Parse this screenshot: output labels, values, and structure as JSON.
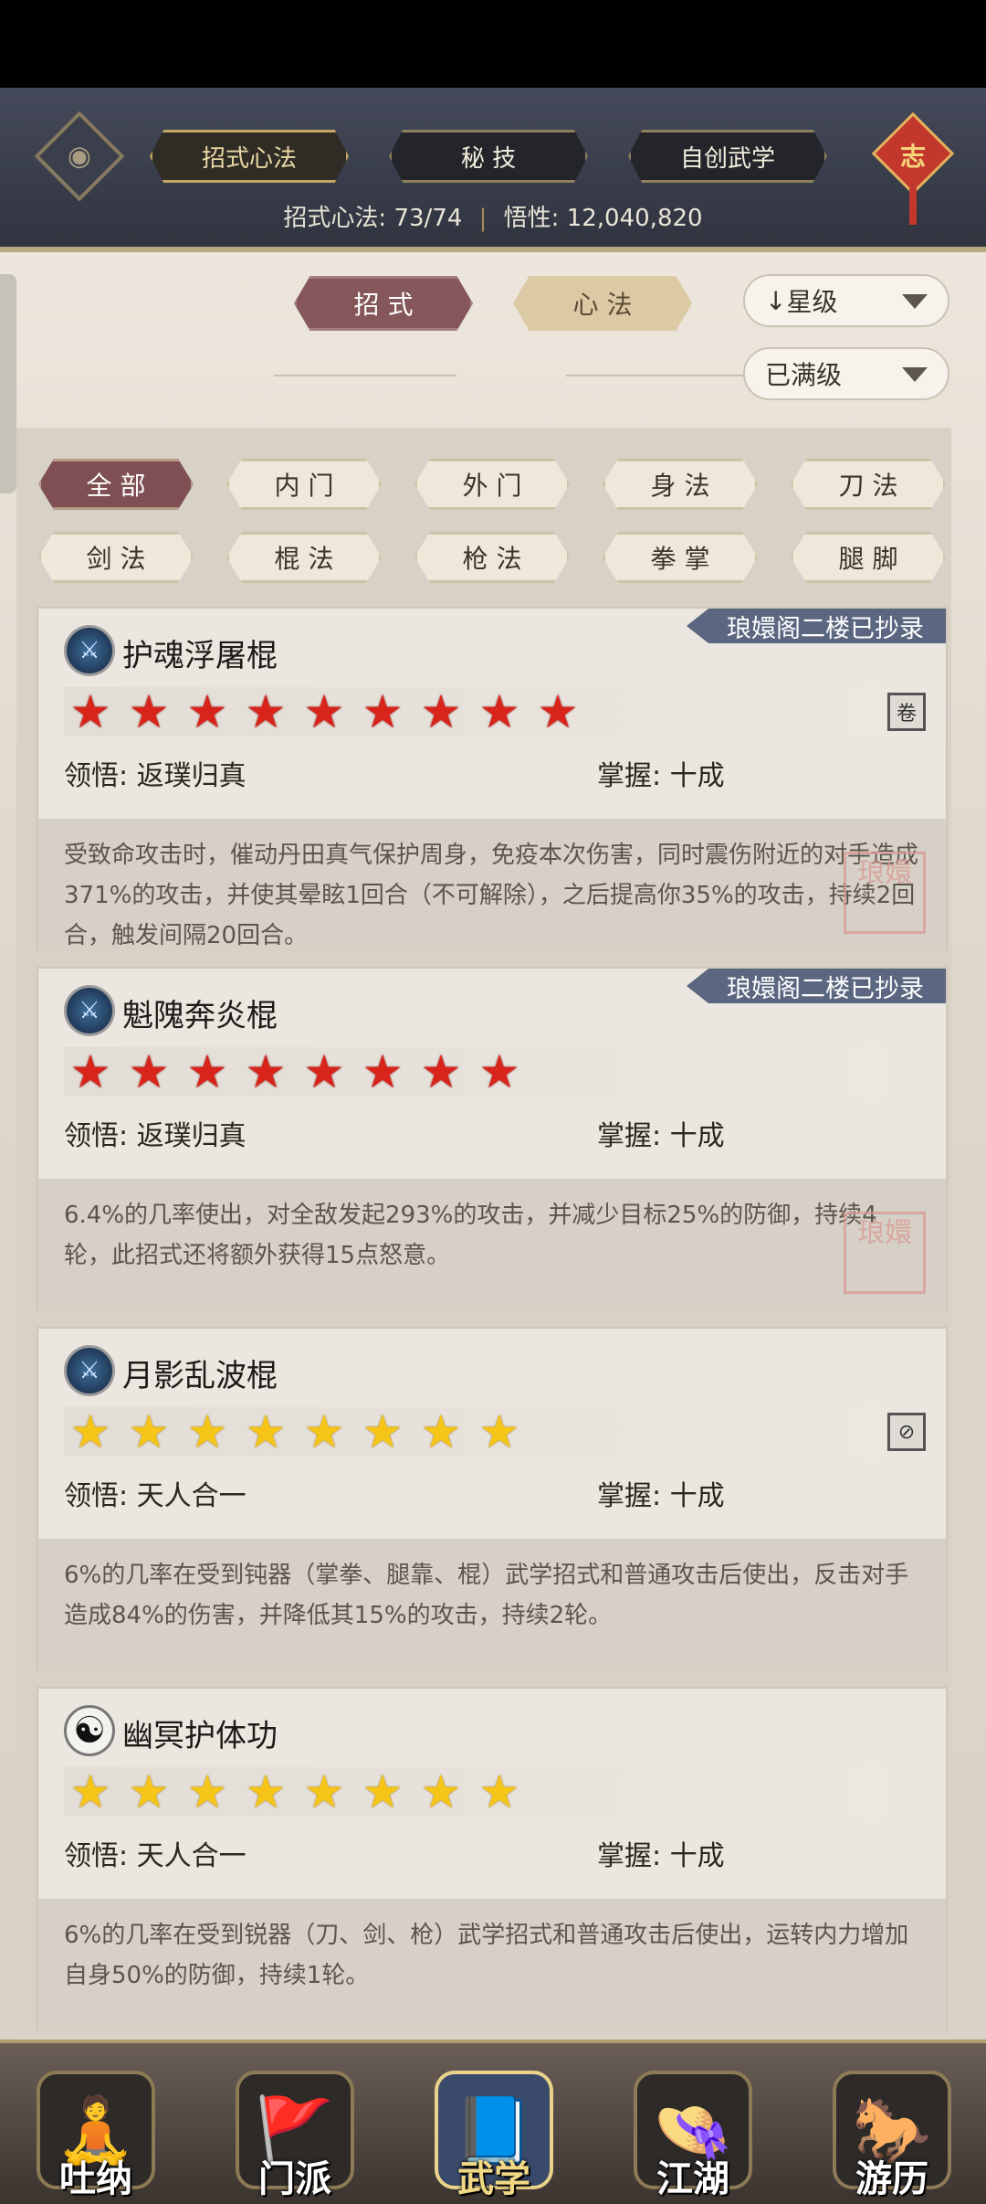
{
  "header": {
    "tabs": [
      "招式心法",
      "秘 技",
      "自创武学"
    ],
    "knot_char": "志",
    "info_label": "招式心法:",
    "info_count": "73/74",
    "wuxing_label": "悟性:",
    "wuxing_value": "12,040,820"
  },
  "subtabs": [
    "招 式",
    "心 法"
  ],
  "sort": {
    "label": "星级",
    "arrow": "↓",
    "filter": "已满级"
  },
  "chips": [
    "全 部",
    "内 门",
    "外 门",
    "身 法",
    "刀 法",
    "剑 法",
    "棍 法",
    "枪 法",
    "拳 掌",
    "腿 脚"
  ],
  "cards": [
    {
      "name": "护魂浮屠棍",
      "badge": "琅嬛阁二楼已抄录",
      "stars": 9,
      "star_color": "red",
      "lingwu_label": "领悟:",
      "lingwu": "返璞归真",
      "zhangwo_label": "掌握:",
      "zhangwo": "十成",
      "desc": "受致命攻击时，催动丹田真气保护周身，免疫本次伤害，同时震伤附近的对手造成371%的攻击，并使其晕眩1回合（不可解除），之后提高你35%的攻击，持续2回合，触发间隔20回合。"
    },
    {
      "name": "魁隗奔炎棍",
      "badge": "琅嬛阁二楼已抄录",
      "stars": 8,
      "star_color": "red",
      "lingwu_label": "领悟:",
      "lingwu": "返璞归真",
      "zhangwo_label": "掌握:",
      "zhangwo": "十成",
      "desc": "6.4%的几率使出，对全敌发起293%的攻击，并减少目标25%的防御，持续4轮，此招式还将额外获得15点怒意。"
    },
    {
      "name": "月影乱波棍",
      "badge": "",
      "stars": 8,
      "star_color": "gold",
      "lingwu_label": "领悟:",
      "lingwu": "天人合一",
      "zhangwo_label": "掌握:",
      "zhangwo": "十成",
      "desc": "6%的几率在受到钝器（掌拳、腿靠、棍）武学招式和普通攻击后使出，反击对手造成84%的伤害，并降低其15%的攻击，持续2轮。"
    },
    {
      "name": "幽冥护体功",
      "badge": "",
      "stars": 8,
      "star_color": "gold",
      "lingwu_label": "领悟:",
      "lingwu": "天人合一",
      "zhangwo_label": "掌握:",
      "zhangwo": "十成",
      "desc": "6%的几率在受到锐器（刀、剑、枪）武学招式和普通攻击后使出，运转内力增加自身50%的防御，持续1轮。"
    }
  ],
  "seal_text": "琅嬛",
  "nav": [
    "吐纳",
    "门派",
    "武学",
    "江湖",
    "游历"
  ]
}
